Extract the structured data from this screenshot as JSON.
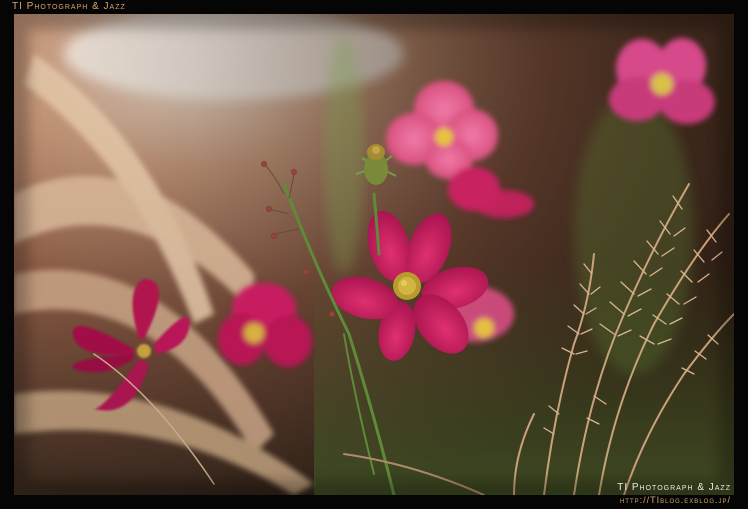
{
  "watermark": {
    "top_left": "TI Photograph & Jazz",
    "bottom_right": "TI Photograph & Jazz",
    "url": "http://TIblog.exblog.jp/"
  },
  "colors": {
    "frame": "#050505",
    "caption_gold": "#d9a86a",
    "flower_magenta": "#c2185b",
    "flower_center": "#c9b03a",
    "grass_beige": "#d9b89a"
  }
}
